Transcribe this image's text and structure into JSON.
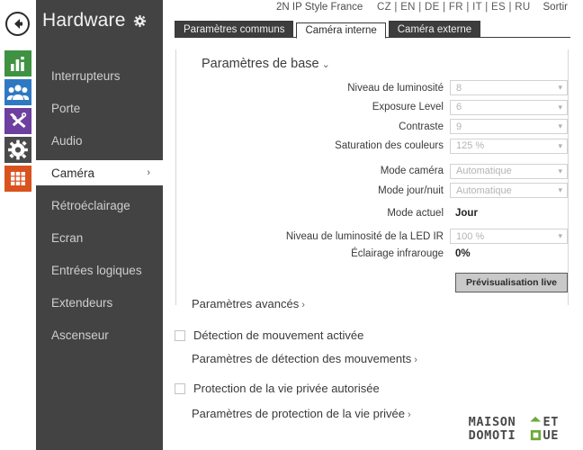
{
  "rail": {
    "back_label": "back-arrow",
    "icons": [
      {
        "name": "stats-icon",
        "color": "#3f9242"
      },
      {
        "name": "users-icon",
        "color": "#2e79c2"
      },
      {
        "name": "tools-icon",
        "color": "#6d3f9e"
      },
      {
        "name": "gear-icon",
        "color": "#4a4a4a"
      },
      {
        "name": "grid-icon",
        "color": "#d9531e"
      }
    ]
  },
  "sidebar": {
    "title": "Hardware",
    "items": [
      {
        "label": "Interrupteurs",
        "active": false
      },
      {
        "label": "Porte",
        "active": false
      },
      {
        "label": "Audio",
        "active": false
      },
      {
        "label": "Caméra",
        "active": true,
        "chevron": "›"
      },
      {
        "label": "Rétroéclairage",
        "active": false
      },
      {
        "label": "Ecran",
        "active": false
      },
      {
        "label": "Entrées logiques",
        "active": false
      },
      {
        "label": "Extendeurs",
        "active": false
      },
      {
        "label": "Ascenseur",
        "active": false
      }
    ]
  },
  "topbar": {
    "brand": "2N IP Style France",
    "languages": "CZ | EN | DE | FR | IT | ES | RU",
    "logout": "Sortir"
  },
  "tabs": [
    {
      "label": "Paramètres communs",
      "active": false
    },
    {
      "label": "Caméra interne",
      "active": true
    },
    {
      "label": "Caméra externe",
      "active": false
    }
  ],
  "basic_settings": {
    "legend": "Paramètres de base",
    "legend_chevron": "⌄",
    "fields": [
      {
        "label": "Niveau de luminosité",
        "value": "8",
        "type": "select"
      },
      {
        "label": "Exposure Level",
        "value": "6",
        "type": "select"
      },
      {
        "label": "Contraste",
        "value": "9",
        "type": "select"
      },
      {
        "label": "Saturation des couleurs",
        "value": "125 %",
        "type": "select"
      },
      {
        "label": "Mode caméra",
        "value": "Automatique",
        "type": "select"
      },
      {
        "label": "Mode jour/nuit",
        "value": "Automatique",
        "type": "select"
      }
    ],
    "current_mode": {
      "label": "Mode actuel",
      "value": "Jour"
    },
    "ir_led": {
      "label": "Niveau de luminosité de la LED IR",
      "value": "100 %"
    },
    "ir_light": {
      "label": "Éclairage infrarouge",
      "value": "0%"
    },
    "preview_button": "Prévisualisation live"
  },
  "links": {
    "advanced": "Paramètres avancés",
    "motion_settings": "Paramètres de détection des mouvements",
    "privacy_settings": "Paramètres de protection de la vie privée",
    "chevron": "›"
  },
  "checkboxes": {
    "motion": {
      "label": "Détection de mouvement activée",
      "checked": false
    },
    "privacy": {
      "label": "Protection de la vie privée autorisée",
      "checked": false
    }
  },
  "watermark": {
    "line1": "MAISON ET",
    "line2": "DOMOTIQUE",
    "accent": "#6fa83a"
  }
}
